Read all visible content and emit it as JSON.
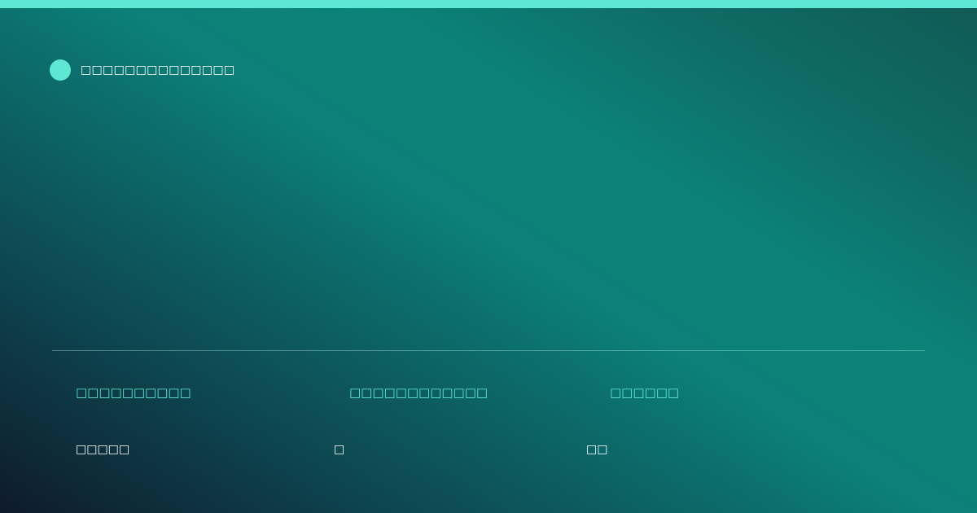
{
  "brand": {
    "name": "□□□□□□□□□□□□□□",
    "accent_color": "#5ee8d4"
  },
  "stats": [
    {
      "label": "□□□□□□□□□□",
      "value": "□□□□□"
    },
    {
      "label": "□□□□□□□□□□□□",
      "value": "□"
    },
    {
      "label": "□□□□□□",
      "value": "□□"
    }
  ]
}
